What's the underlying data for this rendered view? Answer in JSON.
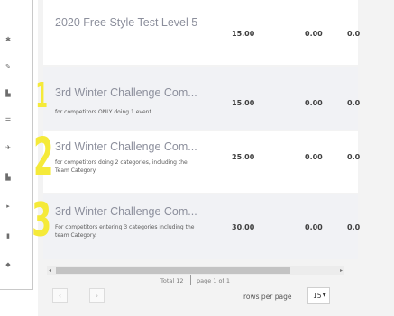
{
  "rail": {
    "icons": [
      "rail-icon-1",
      "rail-icon-2",
      "rail-icon-3",
      "rail-icon-4",
      "rail-icon-5",
      "rail-icon-6",
      "rail-icon-7",
      "rail-icon-8",
      "rail-icon-9"
    ]
  },
  "rows": [
    {
      "title": "2020 Free Style Test Level 5",
      "subtitle": "",
      "c1": "15.00",
      "c2": "0.00",
      "c3": "0.0"
    },
    {
      "title": "3rd Winter Challenge Com...",
      "subtitle": "for competitors ONLY doing 1 event",
      "c1": "15.00",
      "c2": "0.00",
      "c3": "0.0"
    },
    {
      "title": "3rd Winter Challenge Com...",
      "subtitle": "for competitors doing 2 categories, including the Team Category.",
      "c1": "25.00",
      "c2": "0.00",
      "c3": "0.0"
    },
    {
      "title": "3rd Winter Challenge Com...",
      "subtitle": "For competitors entering 3 categories including the team Category.",
      "c1": "30.00",
      "c2": "0.00",
      "c3": "0.0"
    }
  ],
  "annotations": [
    "1",
    "2",
    "3"
  ],
  "pagination": {
    "total": "Total 12",
    "page": "page 1 of 1",
    "prev": "‹",
    "next": "›",
    "rows_per_page_label": "rows per page",
    "rows_per_page_value": "15"
  },
  "colors": {
    "highlighter": "#f5ea39",
    "panel_bg": "#f3f3f3",
    "title_text": "#8c8f9c"
  }
}
